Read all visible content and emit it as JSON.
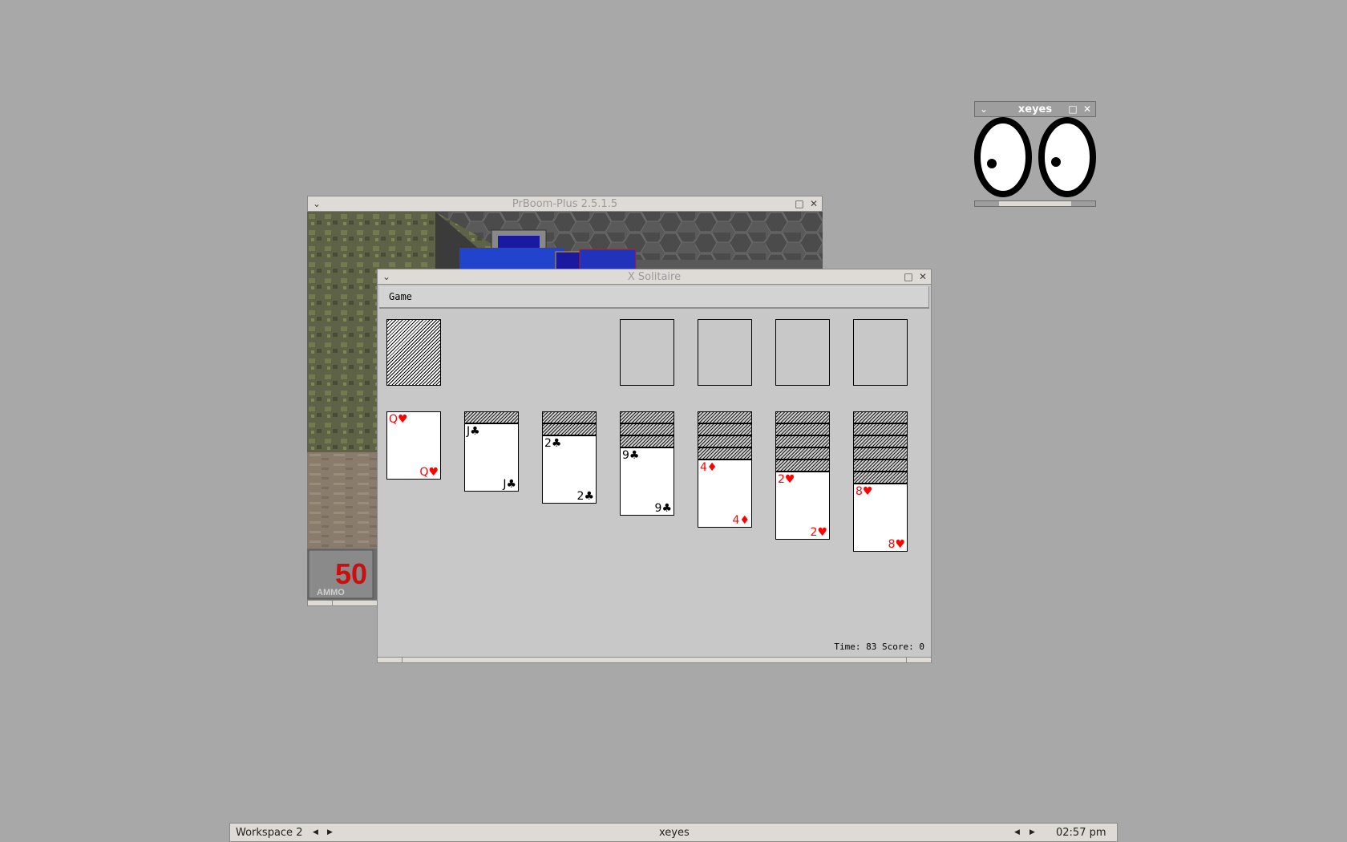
{
  "doom_window": {
    "title": "PrBoom-Plus 2.5.1.5",
    "hud": {
      "ammo_value": "50",
      "ammo_label": "AMMO"
    }
  },
  "solitaire_window": {
    "title": "X Solitaire",
    "menu": {
      "game_label": "Game"
    },
    "status": "Time: 83 Score: 0",
    "tableau": [
      {
        "face_down": 0,
        "rank": "Q",
        "suit": "♥",
        "color": "red"
      },
      {
        "face_down": 1,
        "rank": "J",
        "suit": "♣",
        "color": "black"
      },
      {
        "face_down": 2,
        "rank": "2",
        "suit": "♣",
        "color": "black"
      },
      {
        "face_down": 3,
        "rank": "9",
        "suit": "♣",
        "color": "black"
      },
      {
        "face_down": 4,
        "rank": "4",
        "suit": "♦",
        "color": "red"
      },
      {
        "face_down": 5,
        "rank": "2",
        "suit": "♥",
        "color": "red"
      },
      {
        "face_down": 6,
        "rank": "8",
        "suit": "♥",
        "color": "red"
      }
    ],
    "foundations": 4
  },
  "xeyes_window": {
    "title": "xeyes"
  },
  "taskbar": {
    "workspace": "Workspace 2",
    "active_window": "xeyes",
    "clock": "02:57 pm"
  },
  "colors": {
    "desktop": "#a8a8a8",
    "card_red": "#ff0000",
    "table": "#c8c8c8"
  }
}
